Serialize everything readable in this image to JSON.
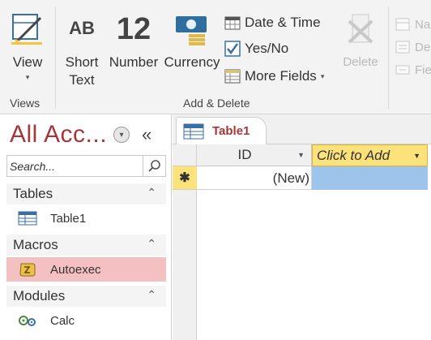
{
  "ribbon": {
    "views_group": {
      "view_label": "View",
      "group_label": "Views"
    },
    "add_delete_group": {
      "short_text_icon": "AB",
      "short_text_label_line1": "Short",
      "short_text_label_line2": "Text",
      "number_icon": "12",
      "number_label": "Number",
      "currency_label": "Currency",
      "date_time_label": "Date & Time",
      "yes_no_label": "Yes/No",
      "more_fields_label": "More Fields",
      "delete_label": "Delete",
      "group_label": "Add & Delete"
    },
    "properties_group": {
      "name_label": "Na",
      "default_label": "De",
      "field_label": "Fie"
    }
  },
  "nav": {
    "title": "All Acc...",
    "search_placeholder": "Search...",
    "categories": [
      {
        "label": "Tables",
        "items": [
          {
            "label": "Table1",
            "icon": "table-icon"
          }
        ]
      },
      {
        "label": "Macros",
        "items": [
          {
            "label": "Autoexec",
            "icon": "macro-icon",
            "selected": true
          }
        ]
      },
      {
        "label": "Modules",
        "items": [
          {
            "label": "Calc",
            "icon": "module-icon"
          }
        ]
      }
    ]
  },
  "document": {
    "tab_label": "Table1",
    "columns": [
      {
        "label": "ID"
      },
      {
        "label": "Click to Add"
      }
    ],
    "new_row": {
      "marker": "✱",
      "id_value": "(New)"
    }
  },
  "colors": {
    "accent": "#a4373a",
    "header_highlight": "#fbe27a",
    "selected_cell": "#9dc5ec",
    "selected_nav": "#f4c0c2"
  }
}
